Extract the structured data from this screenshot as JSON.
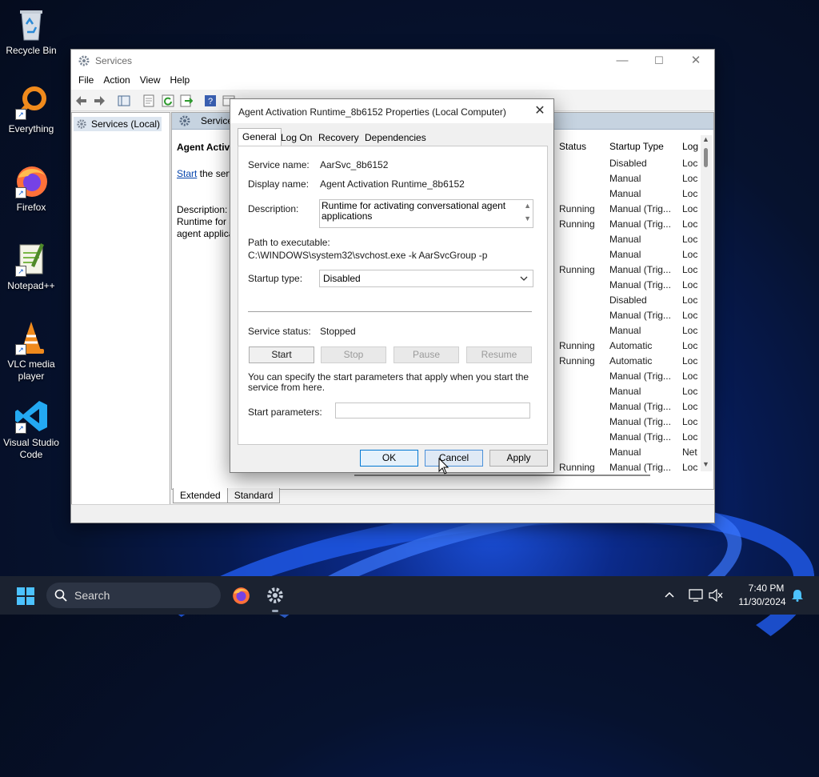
{
  "desktop": {
    "icons": [
      {
        "label": "Recycle Bin",
        "icon": "recycle-bin-icon"
      },
      {
        "label": "Everything",
        "icon": "everything-search-icon"
      },
      {
        "label": "Firefox",
        "icon": "firefox-icon"
      },
      {
        "label": "Notepad++",
        "icon": "notepad-plus-plus-icon"
      },
      {
        "label": "VLC media player",
        "icon": "vlc-icon"
      },
      {
        "label": "Visual Studio Code",
        "icon": "vscode-icon"
      }
    ]
  },
  "services_window": {
    "title": "Services",
    "menu": [
      "File",
      "Action",
      "View",
      "Help"
    ],
    "tree_root": "Services (Local)",
    "pane_header": "Services",
    "selected_service_title": "Agent Activa",
    "start_link": "Start",
    "start_suffix": " the serv",
    "description_label": "Description:",
    "description_line1": "Runtime for a",
    "description_line2": "agent applica",
    "columns": {
      "status": "Status",
      "startup": "Startup Type",
      "logon": "Log"
    },
    "rows": [
      {
        "status": "",
        "startup": "Disabled",
        "logon": "Loc"
      },
      {
        "status": "",
        "startup": "Manual",
        "logon": "Loc"
      },
      {
        "status": "",
        "startup": "Manual",
        "logon": "Loc"
      },
      {
        "status": "Running",
        "startup": "Manual (Trig...",
        "logon": "Loc"
      },
      {
        "status": "Running",
        "startup": "Manual (Trig...",
        "logon": "Loc"
      },
      {
        "status": "",
        "startup": "Manual",
        "logon": "Loc"
      },
      {
        "status": "",
        "startup": "Manual",
        "logon": "Loc"
      },
      {
        "status": "Running",
        "startup": "Manual (Trig...",
        "logon": "Loc"
      },
      {
        "status": "",
        "startup": "Manual (Trig...",
        "logon": "Loc"
      },
      {
        "status": "",
        "startup": "Disabled",
        "logon": "Loc"
      },
      {
        "status": "",
        "startup": "Manual (Trig...",
        "logon": "Loc"
      },
      {
        "status": "",
        "startup": "Manual",
        "logon": "Loc"
      },
      {
        "status": "Running",
        "startup": "Automatic",
        "logon": "Loc"
      },
      {
        "status": "Running",
        "startup": "Automatic",
        "logon": "Loc"
      },
      {
        "status": "",
        "startup": "Manual (Trig...",
        "logon": "Loc"
      },
      {
        "status": "",
        "startup": "Manual",
        "logon": "Loc"
      },
      {
        "status": "",
        "startup": "Manual (Trig...",
        "logon": "Loc"
      },
      {
        "status": "",
        "startup": "Manual (Trig...",
        "logon": "Loc"
      },
      {
        "status": "",
        "startup": "Manual (Trig...",
        "logon": "Loc"
      },
      {
        "status": "",
        "startup": "Manual",
        "logon": "Net"
      },
      {
        "status": "Running",
        "startup": "Manual (Trig...",
        "logon": "Loc"
      }
    ],
    "bottom_tabs": [
      "Extended",
      "Standard"
    ]
  },
  "dialog": {
    "title": "Agent Activation Runtime_8b6152 Properties (Local Computer)",
    "tabs": [
      "General",
      "Log On",
      "Recovery",
      "Dependencies"
    ],
    "service_name_label": "Service name:",
    "service_name": "AarSvc_8b6152",
    "display_name_label": "Display name:",
    "display_name": "Agent Activation Runtime_8b6152",
    "description_label": "Description:",
    "description": "Runtime for activating conversational agent applications",
    "path_label": "Path to executable:",
    "path": "C:\\WINDOWS\\system32\\svchost.exe -k AarSvcGroup -p",
    "startup_type_label": "Startup type:",
    "startup_type": "Disabled",
    "service_status_label": "Service status:",
    "service_status": "Stopped",
    "buttons": {
      "start": "Start",
      "stop": "Stop",
      "pause": "Pause",
      "resume": "Resume"
    },
    "params_help": "You can specify the start parameters that apply when you start the service from here.",
    "start_params_label": "Start parameters:",
    "start_params_value": "",
    "ok": "OK",
    "cancel": "Cancel",
    "apply": "Apply"
  },
  "taskbar": {
    "search_placeholder": "Search",
    "time": "7:40 PM",
    "date": "11/30/2024"
  }
}
